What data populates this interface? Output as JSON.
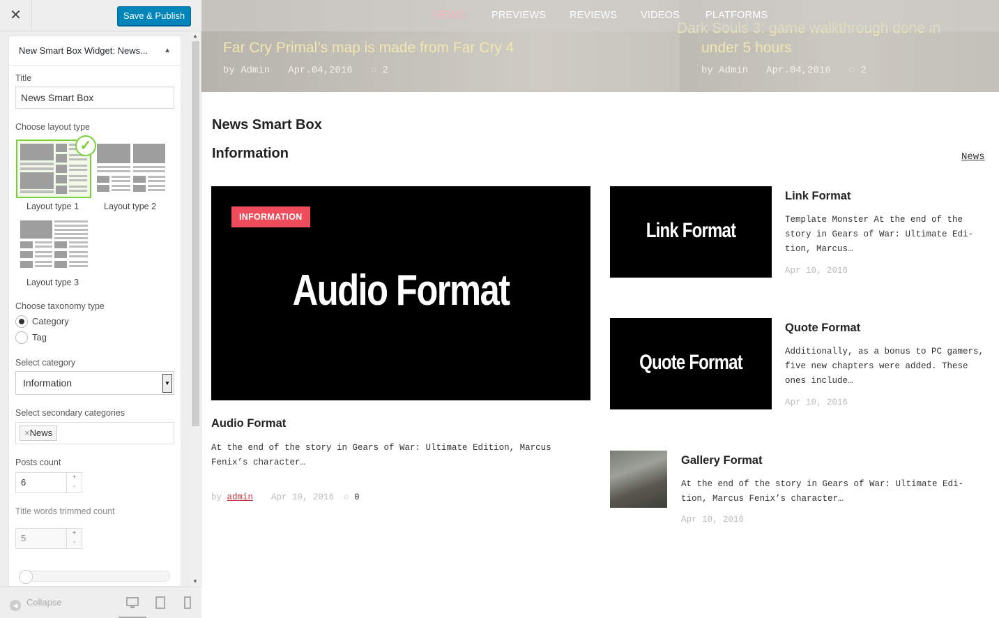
{
  "customizer": {
    "close_label": "✕",
    "save_label": "Save & Publish",
    "widget_title": "New Smart Box Widget: News...",
    "title_label": "Title",
    "title_value": "News Smart Box",
    "layout_label": "Choose layout type",
    "layouts": [
      "Layout type 1",
      "Layout type 2",
      "Layout type 3"
    ],
    "taxonomy_label": "Choose taxonomy type",
    "taxonomy_options": [
      "Category",
      "Tag"
    ],
    "category_label": "Select category",
    "category_value": "Information",
    "secondary_label": "Select secondary categories",
    "secondary_tag": "News",
    "posts_count_label": "Posts count",
    "posts_count_value": "6",
    "trim_label": "Title words trimmed count",
    "trim_value": "5",
    "collapse_label": "Collapse"
  },
  "site": {
    "nav": [
      "NEWS",
      "PREVIEWS",
      "REVIEWS",
      "VIDEOS",
      "PLATFORMS"
    ],
    "slides": [
      {
        "title": "Far Cry Primal’s map is made from Far Cry 4",
        "author": "by Admin",
        "date": "Apr.04,2016",
        "comments": "2"
      },
      {
        "title_line1": "Dark Souls 3: game walkthrough done in",
        "title_line2": "under 5 hours",
        "author": "by Admin",
        "date": "Apr.04,2016",
        "comments": "2"
      }
    ],
    "widget_heading": "News Smart Box",
    "category_heading": "Information",
    "category_link": "News",
    "featured": {
      "badge": "INFORMATION",
      "image_text": "Audio Format",
      "title": "Audio Format",
      "excerpt": "At the end of the story in Gears of War: Ultimate Edition, Marcus Fenix’s character…",
      "by": "by",
      "author": "admin",
      "date": "Apr 10, 2016",
      "comments": "0"
    },
    "side_posts": [
      {
        "image_text": "Link Format",
        "title": "Link Format",
        "excerpt": "Template Monster At the end of the story in Gears of War: Ultimate Edi-tion, Marcus…",
        "date": "Apr 10, 2016"
      },
      {
        "image_text": "Quote Format",
        "title": "Quote Format",
        "excerpt": "Additionally, as a bonus to PC gamers, five new chapters were added. These ones include…",
        "date": "Apr 10, 2016"
      },
      {
        "title": "Gallery Format",
        "excerpt": "At the end of the story in Gears of War: Ultimate Edi-tion, Marcus Fenix’s character…",
        "date": "Apr 10, 2016"
      }
    ]
  },
  "colors": {
    "primary_button": "#0085ba",
    "badge": "#ef4c5b",
    "selected_layout": "#7ad03a"
  }
}
